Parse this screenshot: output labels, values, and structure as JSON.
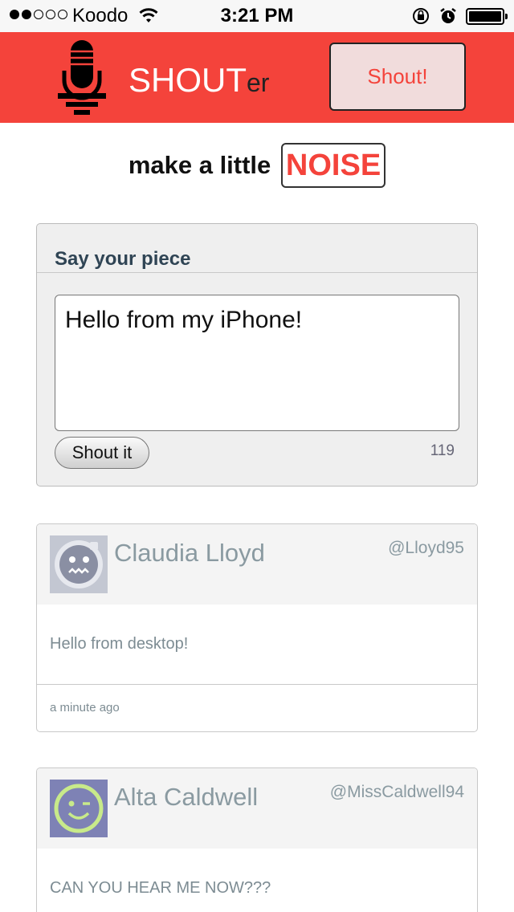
{
  "status_bar": {
    "carrier": "Koodo",
    "time": "3:21 PM",
    "signal_filled": 2,
    "signal_total": 5,
    "battery_level": 1.0
  },
  "header": {
    "brand_main": "SHOUT",
    "brand_suffix": "er",
    "shout_button_label": "Shout!",
    "brand_color": "#f4433b"
  },
  "tagline": {
    "lead": "make a little",
    "highlight": "NOISE"
  },
  "compose": {
    "title": "Say your piece",
    "input_value": "Hello from my iPhone!",
    "submit_label": "Shout it",
    "char_count": "119"
  },
  "posts": [
    {
      "name": "Claudia Lloyd",
      "handle": "@Lloyd95",
      "text": "Hello from desktop!",
      "time": "a minute ago",
      "avatar_icon": "robot-face-icon"
    },
    {
      "name": "Alta Caldwell",
      "handle": "@MissCaldwell94",
      "text": "CAN YOU HEAR ME NOW???",
      "time": "",
      "avatar_icon": "winking-face-icon"
    }
  ]
}
